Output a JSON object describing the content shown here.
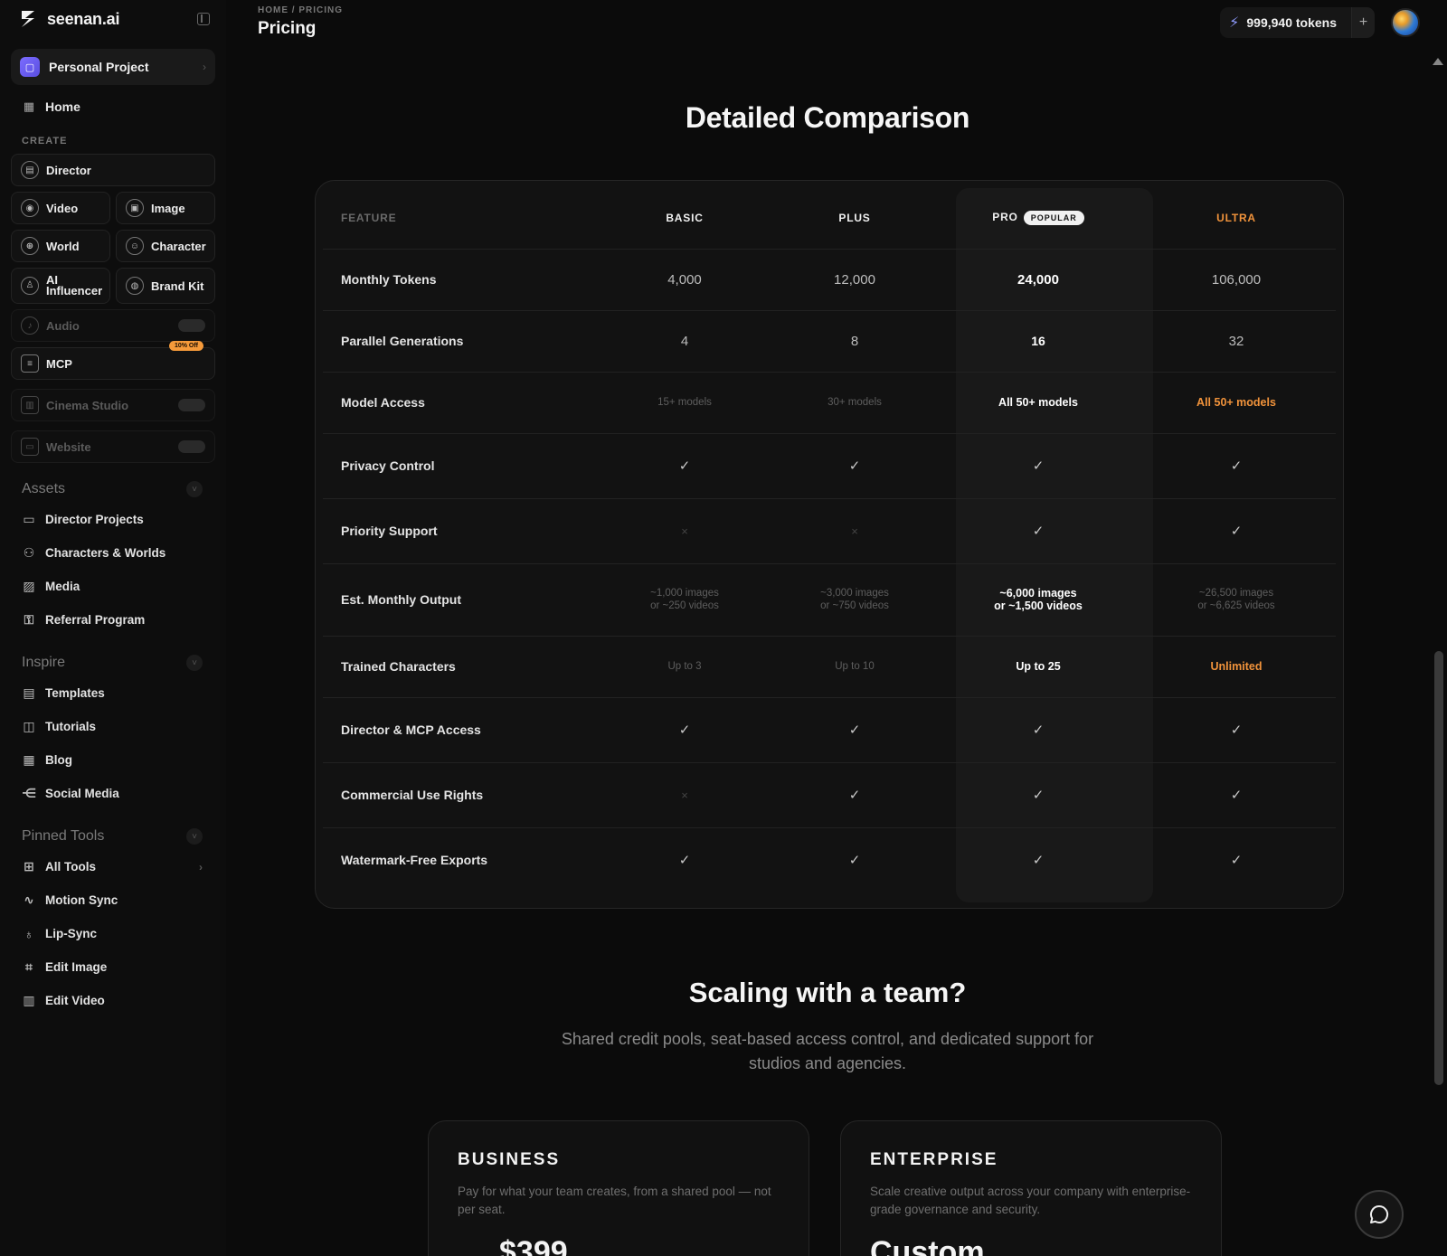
{
  "app": {
    "brand": "seenan.ai"
  },
  "sidebar": {
    "project": "Personal Project",
    "home": "Home",
    "create_label": "CREATE",
    "tiles": {
      "director": "Director",
      "video": "Video",
      "image": "Image",
      "world": "World",
      "character": "Character",
      "ai_influencer": "AI Influencer",
      "brand_kit": "Brand Kit",
      "audio": "Audio",
      "mcp": "MCP",
      "mcp_badge": "10% Off",
      "cinema_studio": "Cinema Studio",
      "website": "Website"
    },
    "assets": {
      "title": "Assets",
      "items": [
        "Director Projects",
        "Characters & Worlds",
        "Media",
        "Referral Program"
      ]
    },
    "inspire": {
      "title": "Inspire",
      "items": [
        "Templates",
        "Tutorials",
        "Blog",
        "Social Media"
      ]
    },
    "pinned": {
      "title": "Pinned Tools",
      "items": [
        "All Tools",
        "Motion Sync",
        "Lip-Sync",
        "Edit Image",
        "Edit Video"
      ]
    }
  },
  "topbar": {
    "breadcrumb": "HOME / PRICING",
    "title": "Pricing",
    "tokens": "999,940 tokens",
    "plus": "+"
  },
  "comparison": {
    "heading": "Detailed Comparison",
    "headers": {
      "feature": "FEATURE",
      "basic": "BASIC",
      "plus": "PLUS",
      "pro": "PRO",
      "popular": "POPULAR",
      "ultra": "ULTRA"
    },
    "rows": [
      {
        "feature": "Monthly Tokens",
        "basic": "4,000",
        "plus": "12,000",
        "pro": "24,000",
        "ultra": "106,000"
      },
      {
        "feature": "Parallel Generations",
        "basic": "4",
        "plus": "8",
        "pro": "16",
        "ultra": "32"
      },
      {
        "feature": "Model Access",
        "basic": "15+ models",
        "plus": "30+ models",
        "pro": "All 50+ models",
        "ultra": "All 50+ models"
      },
      {
        "feature": "Privacy Control",
        "basic": "✓",
        "plus": "✓",
        "pro": "✓",
        "ultra": "✓"
      },
      {
        "feature": "Priority Support",
        "basic": "×",
        "plus": "×",
        "pro": "✓",
        "ultra": "✓"
      },
      {
        "feature": "Est. Monthly Output",
        "basic_1": "~1,000 images",
        "basic_2": "or ~250 videos",
        "plus_1": "~3,000 images",
        "plus_2": "or ~750 videos",
        "pro_1": "~6,000 images",
        "pro_2": "or ~1,500 videos",
        "ultra_1": "~26,500 images",
        "ultra_2": "or ~6,625 videos"
      },
      {
        "feature": "Trained Characters",
        "basic": "Up to 3",
        "plus": "Up to 10",
        "pro": "Up to 25",
        "ultra": "Unlimited"
      },
      {
        "feature": "Director & MCP Access",
        "basic": "✓",
        "plus": "✓",
        "pro": "✓",
        "ultra": "✓"
      },
      {
        "feature": "Commercial Use Rights",
        "basic": "×",
        "plus": "✓",
        "pro": "✓",
        "ultra": "✓"
      },
      {
        "feature": "Watermark-Free Exports",
        "basic": "✓",
        "plus": "✓",
        "pro": "✓",
        "ultra": "✓"
      }
    ]
  },
  "team": {
    "heading": "Scaling with a team?",
    "subtitle": "Shared credit pools, seat-based access control, and dedicated support for studios and agencies.",
    "business": {
      "name": "BUSINESS",
      "desc": "Pay for what your team creates, from a shared pool — not per seat.",
      "price": "$399"
    },
    "enterprise": {
      "name": "ENTERPRISE",
      "desc": "Scale creative output across your company with enterprise-grade governance and security.",
      "price": "Custom"
    }
  },
  "colors": {
    "accent_orange": "#f1933b",
    "brand_purple": "#7b6cff",
    "background": "#0b0b0b"
  }
}
